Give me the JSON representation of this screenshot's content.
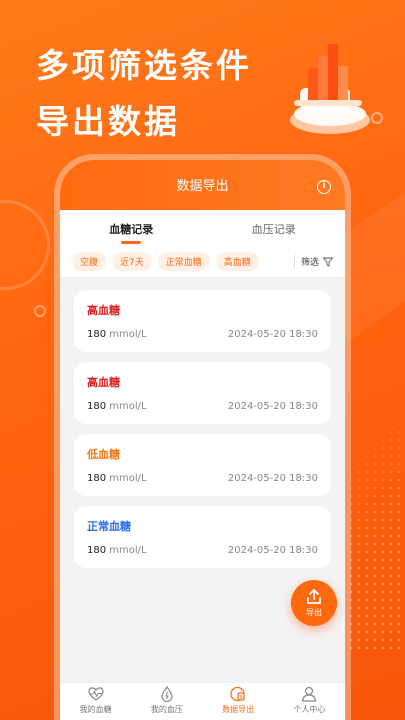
{
  "promo": {
    "line1": "多项筛选条件",
    "line2": "导出数据"
  },
  "app": {
    "title": "数据导出",
    "info_icon": "info-icon"
  },
  "tabs": [
    {
      "label": "血糖记录",
      "active": true
    },
    {
      "label": "血压记录",
      "active": false
    }
  ],
  "filters": {
    "chips": [
      "空腹",
      "近7天",
      "正常血糖",
      "高血糖"
    ],
    "filter_label": "筛选",
    "filter_icon": "funnel-icon"
  },
  "records": [
    {
      "status": "高血糖",
      "value": "180",
      "unit": "mmol/L",
      "time": "2024-05-20 18:30",
      "color": "#e02020"
    },
    {
      "status": "高血糖",
      "value": "180",
      "unit": "mmol/L",
      "time": "2024-05-20 18:30",
      "color": "#e02020"
    },
    {
      "status": "低血糖",
      "value": "180",
      "unit": "mmol/L",
      "time": "2024-05-20 18:30",
      "color": "#f07a10"
    },
    {
      "status": "正常血糖",
      "value": "180",
      "unit": "mmol/L",
      "time": "2024-05-20 18:30",
      "color": "#2a6cf0"
    }
  ],
  "export_button": {
    "label": "导出",
    "icon": "upload-icon"
  },
  "bottom_nav": [
    {
      "label": "我的血糖",
      "icon": "heartbeat-icon",
      "active": false
    },
    {
      "label": "我的血压",
      "icon": "drop-icon",
      "active": false
    },
    {
      "label": "数据导出",
      "icon": "export-doc-icon",
      "active": true
    },
    {
      "label": "个人中心",
      "icon": "user-icon",
      "active": false
    }
  ],
  "colors": {
    "accent": "#ff6a10",
    "chip_bg": "#fff0e6"
  }
}
